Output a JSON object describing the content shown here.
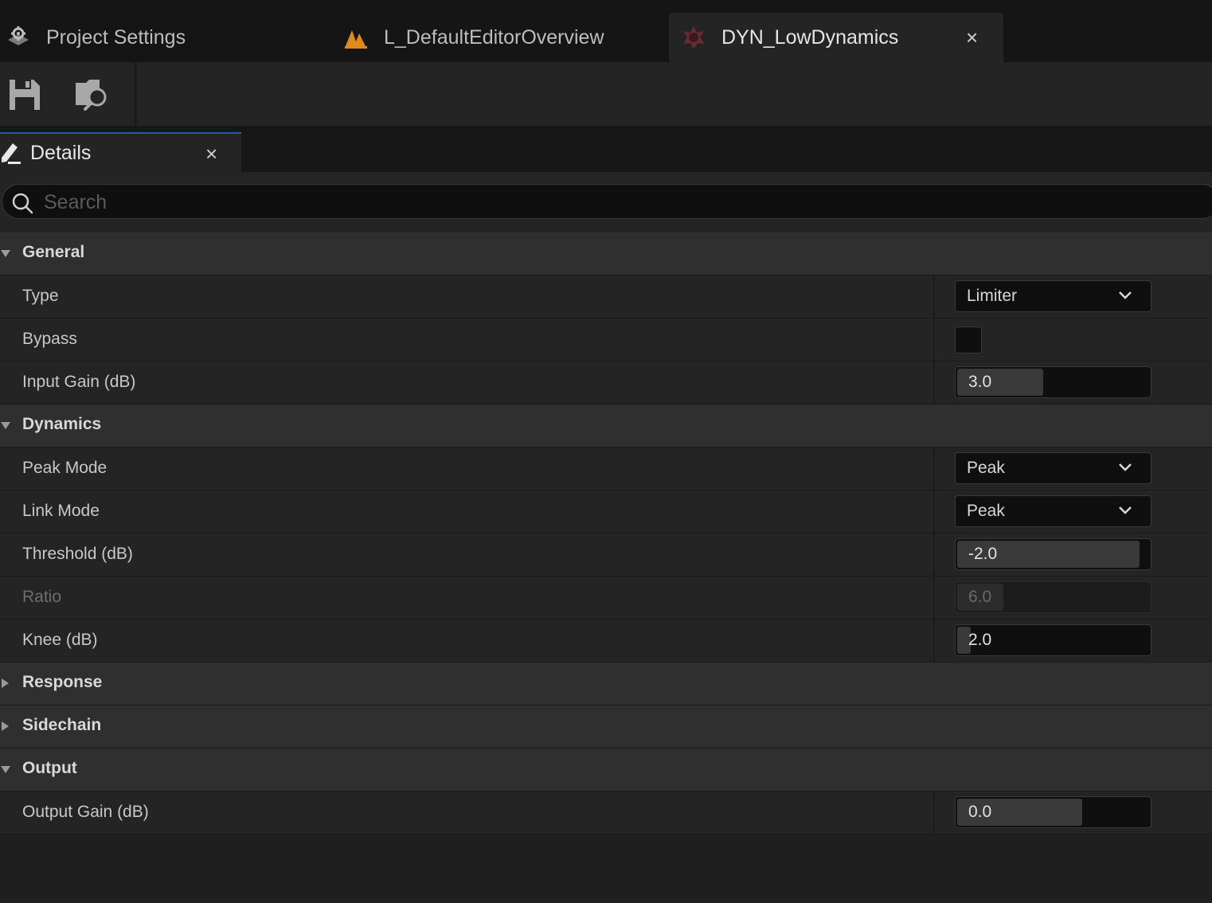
{
  "tabs": [
    {
      "label": "Project Settings",
      "icon": "settings-gear-icon"
    },
    {
      "label": "L_DefaultEditorOverview",
      "icon": "level-icon"
    },
    {
      "label": "DYN_LowDynamics",
      "icon": "dynamics-asset-icon",
      "active": true
    }
  ],
  "toolbar": {
    "save_icon": "save-icon",
    "browse_icon": "browse-to-asset-icon"
  },
  "panel": {
    "title": "Details",
    "icon": "pencil-icon"
  },
  "search": {
    "placeholder": "Search",
    "value": ""
  },
  "sections": {
    "general": {
      "label": "General",
      "type": {
        "label": "Type",
        "value": "Limiter"
      },
      "bypass": {
        "label": "Bypass",
        "checked": false
      },
      "input_gain": {
        "label": "Input Gain (dB)",
        "value": "3.0",
        "fill": 0.45
      }
    },
    "dynamics": {
      "label": "Dynamics",
      "peak_mode": {
        "label": "Peak Mode",
        "value": "Peak"
      },
      "link_mode": {
        "label": "Link Mode",
        "value": "Peak"
      },
      "threshold": {
        "label": "Threshold (dB)",
        "value": "-2.0",
        "fill": 0.95
      },
      "ratio": {
        "label": "Ratio",
        "value": "6.0",
        "fill": 0.24,
        "disabled": true
      },
      "knee": {
        "label": "Knee (dB)",
        "value": "2.0",
        "fill": 0.07
      }
    },
    "response": {
      "label": "Response"
    },
    "sidechain": {
      "label": "Sidechain"
    },
    "output": {
      "label": "Output",
      "output_gain": {
        "label": "Output Gain (dB)",
        "value": "0.0",
        "fill": 0.65
      }
    }
  },
  "colors": {
    "accent": "#2a5a9c",
    "level_icon": "#e08a1e",
    "asset_icon": "#b03a3a"
  }
}
